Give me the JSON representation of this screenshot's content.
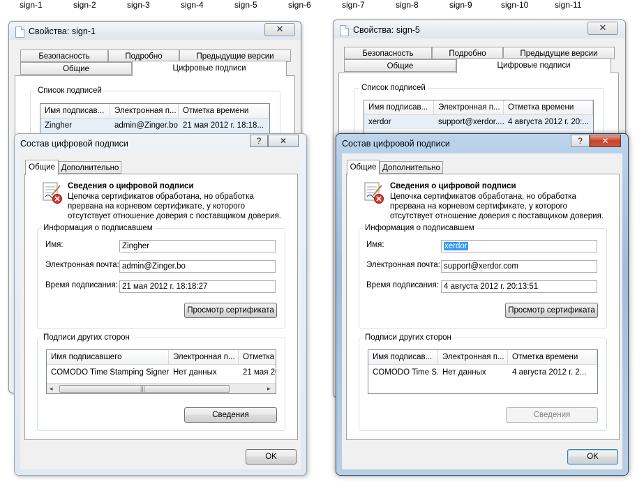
{
  "files": [
    "sign-1",
    "sign-2",
    "sign-3",
    "sign-4",
    "sign-5",
    "sign-6",
    "sign-7",
    "sign-8",
    "sign-9",
    "sign-10",
    "sign-11"
  ],
  "props_left": {
    "title": "Свойства: sign-1",
    "tabs_back": [
      "Безопасность",
      "Подробно",
      "Предыдущие версии"
    ],
    "tabs_front": [
      "Общие",
      "Цифровые подписи"
    ],
    "group_label": "Список подписей",
    "columns": [
      "Имя подписав...",
      "Электронная п...",
      "Отметка времени"
    ],
    "row": [
      "Zingher",
      "admin@Zinger.bo",
      "21 мая 2012 г. 18:18..."
    ]
  },
  "props_right": {
    "title": "Свойства: sign-5",
    "tabs_back": [
      "Безопасность",
      "Подробно",
      "Предыдущие версии"
    ],
    "tabs_front": [
      "Общие",
      "Цифровые подписи"
    ],
    "group_label": "Список подписей",
    "columns": [
      "Имя подписав...",
      "Электронная п...",
      "Отметка времени"
    ],
    "row": [
      "xerdor",
      "support@xerdor....",
      "4 августа 2012 г. 20:..."
    ]
  },
  "dlg_left": {
    "title": "Состав цифровой подписи",
    "help": "?",
    "close": "✕",
    "tabs": [
      "Общие",
      "Дополнительно"
    ],
    "info_title": "Сведения о цифровой подписи",
    "info_text": [
      "Цепочка сертификатов обработана, но обработка",
      "прервана на корневом сертификате, у которого",
      "отсутствует отношение доверия с поставщиком доверия."
    ],
    "signer_group": "Информация о подписавшем",
    "name_label": "Имя:",
    "name_value": "Zingher",
    "email_label": "Электронная почта:",
    "email_value": "admin@Zinger.bo",
    "time_label": "Время подписания:",
    "time_value": " 21  мая  2012  г. 18:18:27",
    "view_cert": "Просмотр сертификата",
    "counter_group": "Подписи других сторон",
    "counter_columns": [
      "Имя подписавшего",
      "Электронная п...",
      "Отметка"
    ],
    "counter_row": [
      "COMODO Time Stamping Signer",
      "Нет данных",
      "21 мая 20"
    ],
    "details": "Сведения",
    "ok": "OK",
    "scroll_grip": "|||",
    "scroll_left": "◂",
    "scroll_right": "▸"
  },
  "dlg_right": {
    "title": "Состав цифровой подписи",
    "help": "?",
    "close": "✕",
    "tabs": [
      "Общие",
      "Дополнительно"
    ],
    "info_title": "Сведения о цифровой подписи",
    "info_text": [
      "Цепочка сертификатов обработана, но обработка",
      "прервана на корневом сертификате, у которого",
      "отсутствует отношение доверия с поставщиком доверия."
    ],
    "signer_group": "Информация о подписавшем",
    "name_label": "Имя:",
    "name_value": "xerdor",
    "email_label": "Электронная почта:",
    "email_value": "support@xerdor.com",
    "time_label": "Время подписания:",
    "time_value": " 4  августа  2012  г. 20:13:51",
    "view_cert": "Просмотр сертификата",
    "counter_group": "Подписи других сторон",
    "counter_columns": [
      "Имя подписав...",
      "Электронная п...",
      "Отметка времени"
    ],
    "counter_row": [
      "COMODO Time S...",
      "Нет данных",
      "4 августа 2012 г. 2..."
    ],
    "details": "Сведения",
    "ok": "OK"
  },
  "colors": {
    "selection": "#3399ff",
    "active_frame": "#9fbcda",
    "close_red": "#c7432a"
  }
}
